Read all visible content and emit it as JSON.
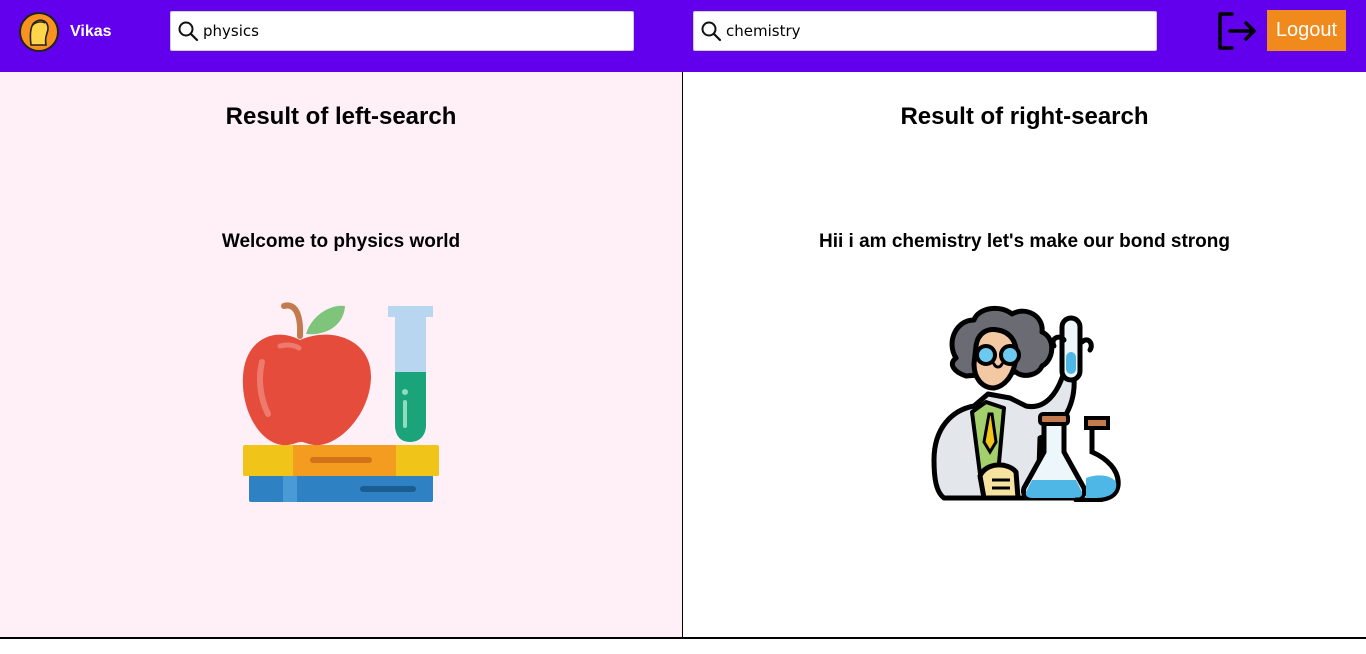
{
  "header": {
    "user_name": "Vikas",
    "left_search": {
      "value": "physics",
      "placeholder": ""
    },
    "right_search": {
      "value": "chemistry",
      "placeholder": ""
    },
    "logout_label": "Logout",
    "icons": [
      "avatar",
      "search-icon",
      "logout-icon"
    ]
  },
  "left_panel": {
    "title": "Result of left-search",
    "message": "Welcome to physics world",
    "illustration": "apple-books-test-tube-icon"
  },
  "right_panel": {
    "title": "Result of right-search",
    "message": "Hii i am chemistry let's make our bond strong",
    "illustration": "scientist-icon"
  },
  "colors": {
    "header_bg": "#6200ee",
    "logout_bg": "#f08a1c",
    "left_panel_bg": "#fff0f8",
    "right_panel_bg": "#ffffff"
  }
}
